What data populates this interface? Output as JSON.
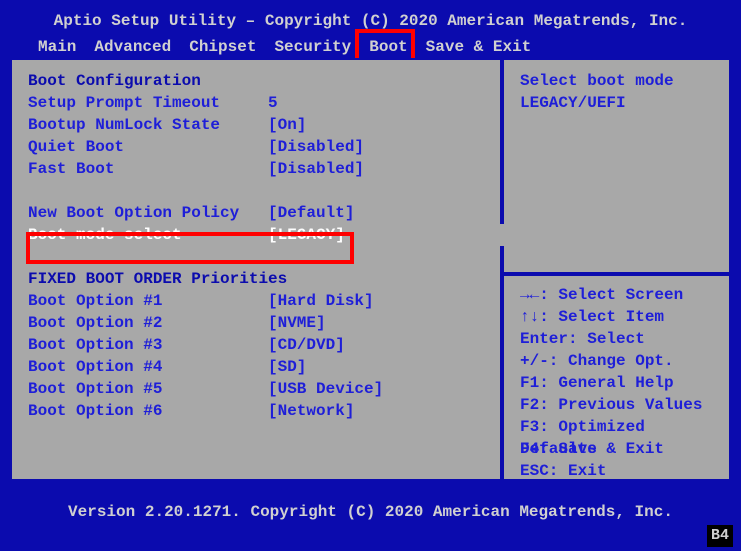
{
  "header": {
    "title": "Aptio Setup Utility – Copyright (C) 2020 American Megatrends, Inc."
  },
  "menu": {
    "items": [
      "Main",
      "Advanced",
      "Chipset",
      "Security",
      "Boot",
      "Save & Exit"
    ],
    "active_index": 4
  },
  "left": {
    "section1": "Boot Configuration",
    "rows1": [
      {
        "label": "Setup Prompt Timeout",
        "value": "5"
      },
      {
        "label": "Bootup NumLock State",
        "value": "[On]"
      },
      {
        "label": "Quiet Boot",
        "value": "[Disabled]"
      },
      {
        "label": "Fast Boot",
        "value": "[Disabled]"
      }
    ],
    "rows2": [
      {
        "label": "New Boot Option Policy",
        "value": "[Default]"
      }
    ],
    "hotrow": {
      "label": "Boot mode select",
      "value": "[LEGACY]"
    },
    "section2": "FIXED BOOT ORDER Priorities",
    "rows3": [
      {
        "label": "Boot Option #1",
        "value": "[Hard Disk]"
      },
      {
        "label": "Boot Option #2",
        "value": "[NVME]"
      },
      {
        "label": "Boot Option #3",
        "value": "[CD/DVD]"
      },
      {
        "label": "Boot Option #4",
        "value": "[SD]"
      },
      {
        "label": "Boot Option #5",
        "value": "[USB Device]"
      },
      {
        "label": "Boot Option #6",
        "value": "[Network]"
      }
    ]
  },
  "right": {
    "desc1": "Select boot mode",
    "desc2": "LEGACY/UEFI",
    "help": [
      "→←: Select Screen",
      "↑↓: Select Item",
      "Enter: Select",
      "+/-: Change Opt.",
      "F1: General Help",
      "F2: Previous Values",
      "F3: Optimized Defaults",
      "F4: Save & Exit",
      "ESC: Exit"
    ]
  },
  "footer": {
    "version": "Version 2.20.1271. Copyright (C) 2020 American Megatrends, Inc.",
    "corner": "B4"
  }
}
